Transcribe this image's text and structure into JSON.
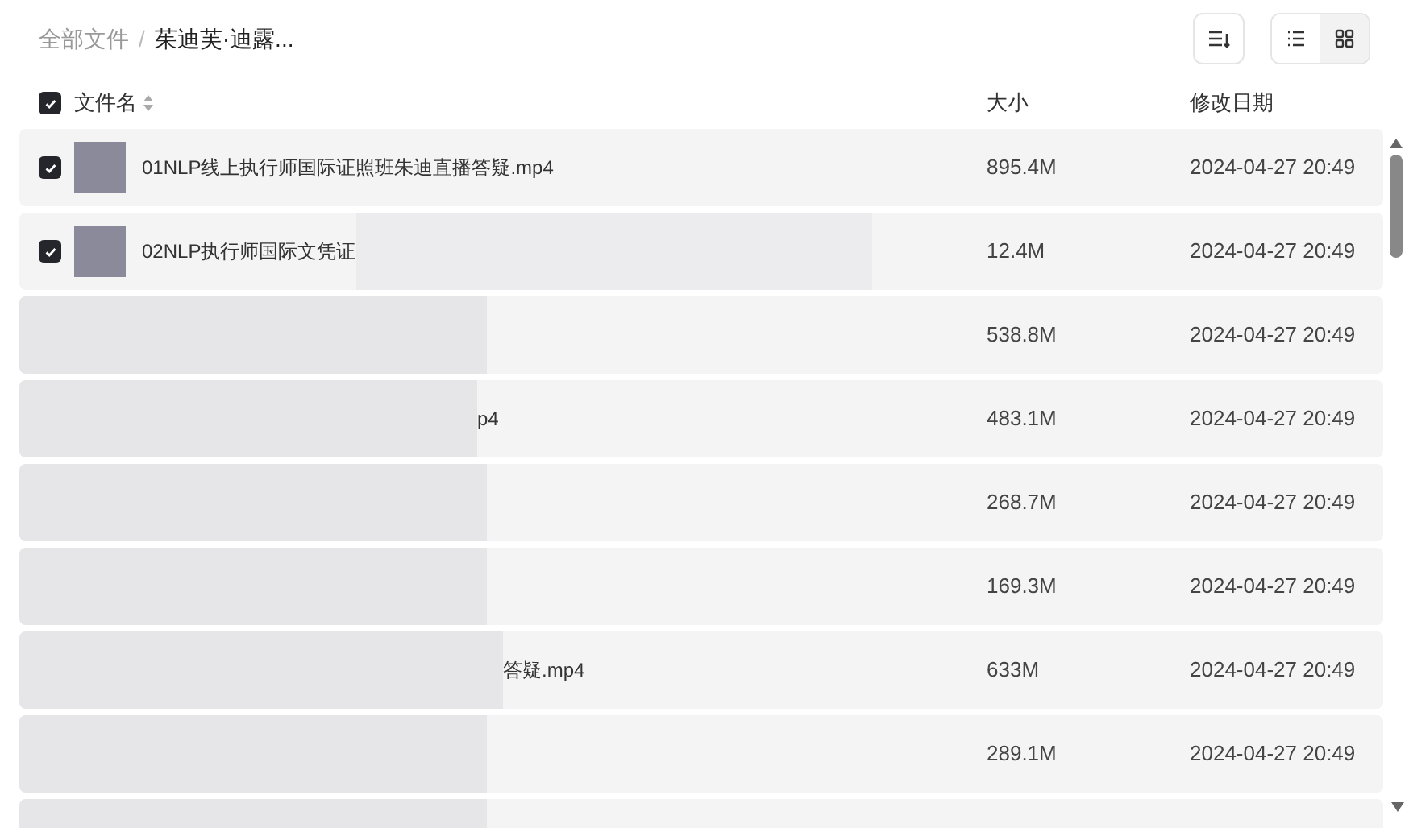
{
  "breadcrumb_separator": "/",
  "breadcrumb": [
    {
      "label": "全部文件",
      "selected": false
    },
    {
      "label": "茱迪芙·迪露...",
      "selected": true
    }
  ],
  "view_toggle": [
    {
      "kind": "list",
      "selected": true
    },
    {
      "kind": "grid",
      "selected": false
    }
  ],
  "header": {
    "checked": true,
    "name": "文件名",
    "size": "大小",
    "date": "修改日期"
  },
  "rows": [
    {
      "kind": "plain",
      "checked": true,
      "name": "01NLP线上执行师国际证照班朱迪直播答疑.mp4",
      "size": "895.4M",
      "date": "2024-04-27 20:49"
    },
    {
      "kind": "name_cut",
      "checked": true,
      "name": "02NLP执行师国际文凭证",
      "size": "12.4M",
      "date": "2024-04-27 20:49"
    },
    {
      "kind": "obscured",
      "size": "538.8M",
      "date": "2024-04-27 20:49"
    },
    {
      "kind": "obscured",
      "name": "p4",
      "size": "483.1M",
      "date": "2024-04-27 20:49"
    },
    {
      "kind": "obscured",
      "size": "268.7M",
      "date": "2024-04-27 20:49"
    },
    {
      "kind": "obscured",
      "size": "169.3M",
      "date": "2024-04-27 20:49"
    },
    {
      "kind": "obscured",
      "name": "答疑.mp4",
      "size": "633M",
      "date": "2024-04-27 20:49"
    },
    {
      "kind": "obscured",
      "size": "289.1M",
      "date": "2024-04-27 20:49"
    },
    {
      "kind": "obscured"
    }
  ]
}
